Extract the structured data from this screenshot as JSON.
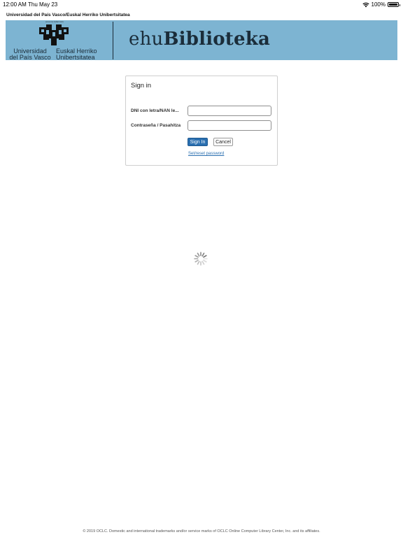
{
  "status_bar": {
    "time": "12:00 AM",
    "date": "Thu May 23",
    "battery": "100%",
    "battery_level": 1.0,
    "wifi_icon": "wifi-icon",
    "battery_icon": "battery-icon"
  },
  "header": {
    "institution": "Universidad del País Vasco/Euskal Herriko Unibertsitatea",
    "banner_color": "#7db4d2",
    "logo": {
      "motto": "eman ta zabal zazu",
      "name_es_line1": "Universidad",
      "name_es_line2": "del País Vasco",
      "name_eu_line1": "Euskal Herriko",
      "name_eu_line2": "Unibertsitatea"
    },
    "brand_prefix": "ehu",
    "brand_suffix": "Biblioteka"
  },
  "signin": {
    "title": "Sign in",
    "user_label": "DNI con letra/NAN le...",
    "user_value": "",
    "user_placeholder": "",
    "password_label": "Contraseña / Pasahitza",
    "password_value": "",
    "password_placeholder": "",
    "signin_button": "Sign In",
    "cancel_button": "Cancel",
    "reset_link": "Set/reset password",
    "accent_color": "#2a6fb0"
  },
  "loading": {
    "icon": "loading-spinner-icon"
  },
  "footer": {
    "text": "© 2019 OCLC. Domestic and international trademarks and/or service marks of OCLC Online Computer Library Center, Inc. and its affiliates."
  }
}
